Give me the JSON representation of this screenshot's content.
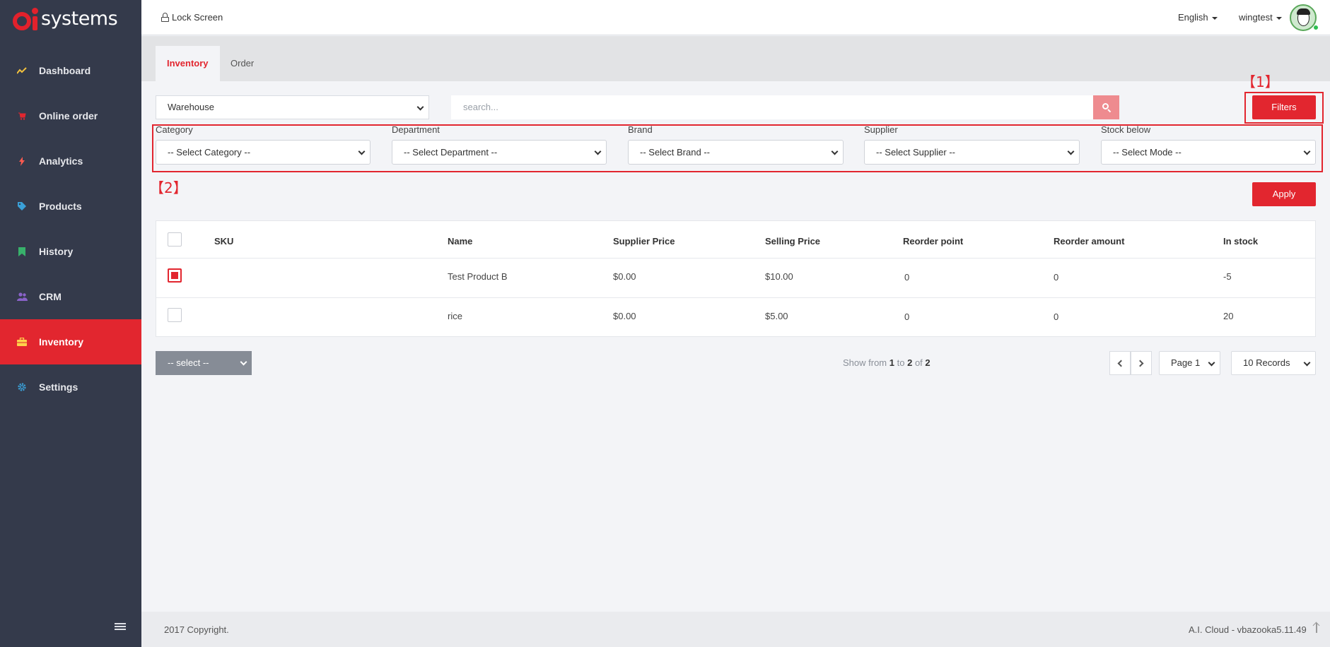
{
  "app": {
    "logo_text": "systems"
  },
  "sidebar": {
    "items": [
      {
        "label": "Dashboard",
        "icon": "chart-line-icon",
        "color": "#f2c13d"
      },
      {
        "label": "Online order",
        "icon": "cart-icon",
        "color": "#e2262f"
      },
      {
        "label": "Analytics",
        "icon": "bolt-icon",
        "color": "#ff5a4f"
      },
      {
        "label": "Products",
        "icon": "tags-icon",
        "color": "#3aa0d8"
      },
      {
        "label": "History",
        "icon": "bookmark-icon",
        "color": "#38b16b"
      },
      {
        "label": "CRM",
        "icon": "users-icon",
        "color": "#8a63c9"
      },
      {
        "label": "Inventory",
        "icon": "briefcase-icon",
        "color": "#ffd24a",
        "active": true
      },
      {
        "label": "Settings",
        "icon": "gear-icon",
        "color": "#3aa0d8"
      }
    ]
  },
  "topbar": {
    "lock_label": "Lock Screen",
    "language": "English",
    "username": "wingtest"
  },
  "tabs": [
    {
      "label": "Inventory",
      "active": true
    },
    {
      "label": "Order",
      "active": false
    }
  ],
  "toolbar": {
    "warehouse_value": "Warehouse",
    "search_placeholder": "search...",
    "filters_label": "Filters",
    "apply_label": "Apply"
  },
  "markers": {
    "one": "【1】",
    "two": "【2】"
  },
  "filters": [
    {
      "label": "Category",
      "value": "-- Select Category --"
    },
    {
      "label": "Department",
      "value": "-- Select Department --"
    },
    {
      "label": "Brand",
      "value": "-- Select Brand --"
    },
    {
      "label": "Supplier",
      "value": "-- Select Supplier --"
    },
    {
      "label": "Stock below",
      "value": "-- Select Mode --"
    }
  ],
  "table": {
    "columns": [
      "SKU",
      "Name",
      "Supplier Price",
      "Selling Price",
      "Reorder point",
      "Reorder amount",
      "In stock"
    ],
    "rows": [
      {
        "checked": true,
        "sku": "",
        "name": "Test Product B",
        "supplier_price": "$0.00",
        "selling_price": "$10.00",
        "reorder_point": "0",
        "reorder_amount": "0",
        "in_stock": "-5"
      },
      {
        "checked": false,
        "sku": "",
        "name": "rice",
        "supplier_price": "$0.00",
        "selling_price": "$5.00",
        "reorder_point": "0",
        "reorder_amount": "0",
        "in_stock": "20"
      }
    ]
  },
  "pagination": {
    "bulk_select": "-- select --",
    "show_prefix": "Show from",
    "from": "1",
    "to_word": "to",
    "to": "2",
    "of_word": "of",
    "total": "2",
    "page_value": "Page 1",
    "records_value": "10 Records"
  },
  "footer": {
    "copyright": "2017 Copyright.",
    "version": "A.I. Cloud - vbazooka5.11.49"
  }
}
